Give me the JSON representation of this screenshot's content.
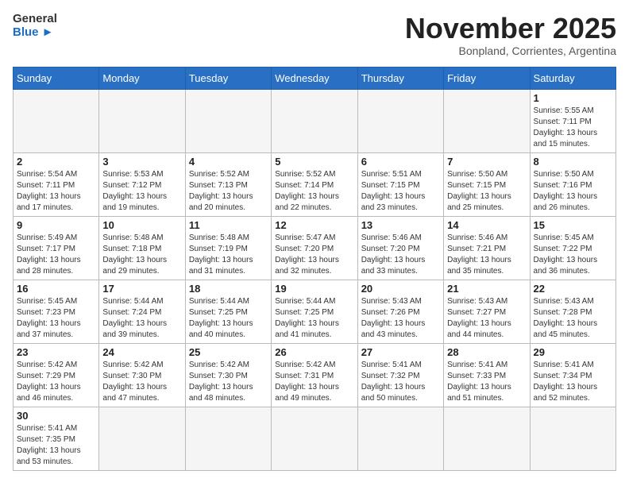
{
  "header": {
    "logo_general": "General",
    "logo_blue": "Blue",
    "month_title": "November 2025",
    "subtitle": "Bonpland, Corrientes, Argentina"
  },
  "weekdays": [
    "Sunday",
    "Monday",
    "Tuesday",
    "Wednesday",
    "Thursday",
    "Friday",
    "Saturday"
  ],
  "weeks": [
    [
      {
        "day": "",
        "info": ""
      },
      {
        "day": "",
        "info": ""
      },
      {
        "day": "",
        "info": ""
      },
      {
        "day": "",
        "info": ""
      },
      {
        "day": "",
        "info": ""
      },
      {
        "day": "",
        "info": ""
      },
      {
        "day": "1",
        "info": "Sunrise: 5:55 AM\nSunset: 7:11 PM\nDaylight: 13 hours and 15 minutes."
      }
    ],
    [
      {
        "day": "2",
        "info": "Sunrise: 5:54 AM\nSunset: 7:11 PM\nDaylight: 13 hours and 17 minutes."
      },
      {
        "day": "3",
        "info": "Sunrise: 5:53 AM\nSunset: 7:12 PM\nDaylight: 13 hours and 19 minutes."
      },
      {
        "day": "4",
        "info": "Sunrise: 5:52 AM\nSunset: 7:13 PM\nDaylight: 13 hours and 20 minutes."
      },
      {
        "day": "5",
        "info": "Sunrise: 5:52 AM\nSunset: 7:14 PM\nDaylight: 13 hours and 22 minutes."
      },
      {
        "day": "6",
        "info": "Sunrise: 5:51 AM\nSunset: 7:15 PM\nDaylight: 13 hours and 23 minutes."
      },
      {
        "day": "7",
        "info": "Sunrise: 5:50 AM\nSunset: 7:15 PM\nDaylight: 13 hours and 25 minutes."
      },
      {
        "day": "8",
        "info": "Sunrise: 5:50 AM\nSunset: 7:16 PM\nDaylight: 13 hours and 26 minutes."
      }
    ],
    [
      {
        "day": "9",
        "info": "Sunrise: 5:49 AM\nSunset: 7:17 PM\nDaylight: 13 hours and 28 minutes."
      },
      {
        "day": "10",
        "info": "Sunrise: 5:48 AM\nSunset: 7:18 PM\nDaylight: 13 hours and 29 minutes."
      },
      {
        "day": "11",
        "info": "Sunrise: 5:48 AM\nSunset: 7:19 PM\nDaylight: 13 hours and 31 minutes."
      },
      {
        "day": "12",
        "info": "Sunrise: 5:47 AM\nSunset: 7:20 PM\nDaylight: 13 hours and 32 minutes."
      },
      {
        "day": "13",
        "info": "Sunrise: 5:46 AM\nSunset: 7:20 PM\nDaylight: 13 hours and 33 minutes."
      },
      {
        "day": "14",
        "info": "Sunrise: 5:46 AM\nSunset: 7:21 PM\nDaylight: 13 hours and 35 minutes."
      },
      {
        "day": "15",
        "info": "Sunrise: 5:45 AM\nSunset: 7:22 PM\nDaylight: 13 hours and 36 minutes."
      }
    ],
    [
      {
        "day": "16",
        "info": "Sunrise: 5:45 AM\nSunset: 7:23 PM\nDaylight: 13 hours and 37 minutes."
      },
      {
        "day": "17",
        "info": "Sunrise: 5:44 AM\nSunset: 7:24 PM\nDaylight: 13 hours and 39 minutes."
      },
      {
        "day": "18",
        "info": "Sunrise: 5:44 AM\nSunset: 7:25 PM\nDaylight: 13 hours and 40 minutes."
      },
      {
        "day": "19",
        "info": "Sunrise: 5:44 AM\nSunset: 7:25 PM\nDaylight: 13 hours and 41 minutes."
      },
      {
        "day": "20",
        "info": "Sunrise: 5:43 AM\nSunset: 7:26 PM\nDaylight: 13 hours and 43 minutes."
      },
      {
        "day": "21",
        "info": "Sunrise: 5:43 AM\nSunset: 7:27 PM\nDaylight: 13 hours and 44 minutes."
      },
      {
        "day": "22",
        "info": "Sunrise: 5:43 AM\nSunset: 7:28 PM\nDaylight: 13 hours and 45 minutes."
      }
    ],
    [
      {
        "day": "23",
        "info": "Sunrise: 5:42 AM\nSunset: 7:29 PM\nDaylight: 13 hours and 46 minutes."
      },
      {
        "day": "24",
        "info": "Sunrise: 5:42 AM\nSunset: 7:30 PM\nDaylight: 13 hours and 47 minutes."
      },
      {
        "day": "25",
        "info": "Sunrise: 5:42 AM\nSunset: 7:30 PM\nDaylight: 13 hours and 48 minutes."
      },
      {
        "day": "26",
        "info": "Sunrise: 5:42 AM\nSunset: 7:31 PM\nDaylight: 13 hours and 49 minutes."
      },
      {
        "day": "27",
        "info": "Sunrise: 5:41 AM\nSunset: 7:32 PM\nDaylight: 13 hours and 50 minutes."
      },
      {
        "day": "28",
        "info": "Sunrise: 5:41 AM\nSunset: 7:33 PM\nDaylight: 13 hours and 51 minutes."
      },
      {
        "day": "29",
        "info": "Sunrise: 5:41 AM\nSunset: 7:34 PM\nDaylight: 13 hours and 52 minutes."
      }
    ],
    [
      {
        "day": "30",
        "info": "Sunrise: 5:41 AM\nSunset: 7:35 PM\nDaylight: 13 hours and 53 minutes."
      },
      {
        "day": "",
        "info": ""
      },
      {
        "day": "",
        "info": ""
      },
      {
        "day": "",
        "info": ""
      },
      {
        "day": "",
        "info": ""
      },
      {
        "day": "",
        "info": ""
      },
      {
        "day": "",
        "info": ""
      }
    ]
  ]
}
